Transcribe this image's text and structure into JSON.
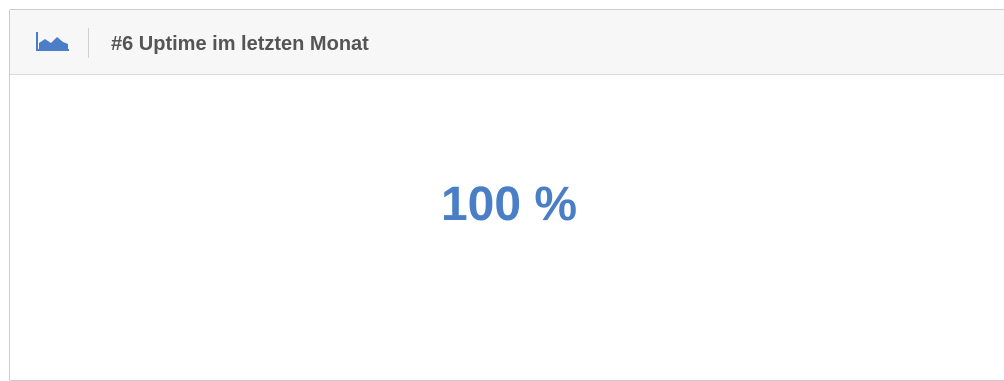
{
  "widget": {
    "header_icon": "area-chart-icon",
    "title": "#6 Uptime im letzten Monat",
    "value": "100 %",
    "accent_color": "#4a7fc7"
  }
}
